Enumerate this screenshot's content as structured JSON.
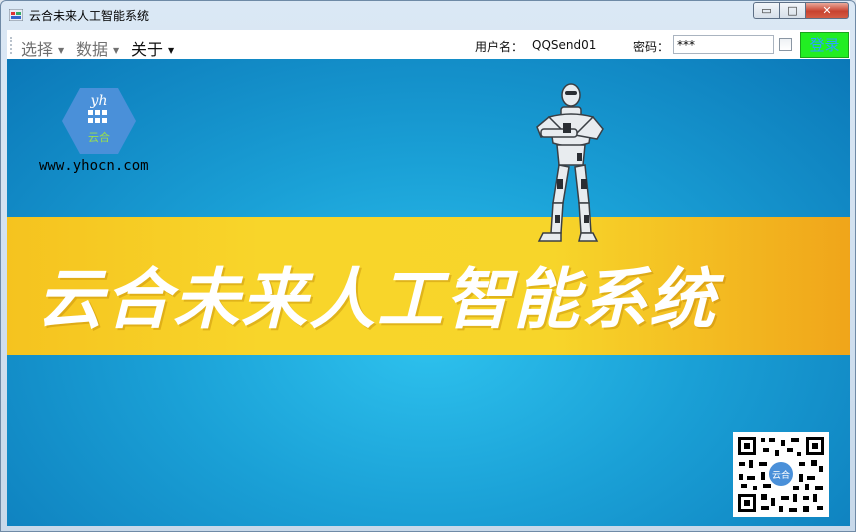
{
  "window": {
    "title": "云合未来人工智能系统",
    "controls": {
      "minimize": "▭",
      "maximize": "□",
      "close": "✕"
    }
  },
  "menubar": {
    "items": [
      {
        "label": "选择",
        "has_dropdown": true
      },
      {
        "label": "数据",
        "has_dropdown": true
      },
      {
        "label": "关于",
        "has_dropdown": true
      }
    ],
    "username_label": "用户名：",
    "username_value": "QQSend01",
    "password_label": "密码：",
    "password_value": "***",
    "remember_checked": false,
    "login_label": "登录"
  },
  "banner": {
    "logo_text": "yh",
    "logo_sub": "云合",
    "logo_url": "www.yhocn.com",
    "band_text": "云合未来人工智能系统",
    "qr_center_text": "云合"
  },
  "colors": {
    "band": "#f8d52a",
    "background": "#1aa0d6",
    "login_button": "#22ee22",
    "login_text": "#2aa3ff",
    "logo": "#4a90d9"
  }
}
